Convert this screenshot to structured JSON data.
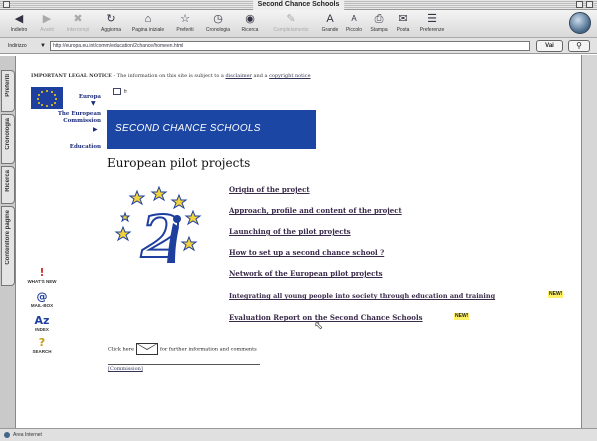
{
  "window": {
    "title": "Second Chance Schools"
  },
  "toolbar": {
    "buttons": [
      {
        "label": "Indietro",
        "icon": "back-arrow-icon",
        "enabled": true
      },
      {
        "label": "Avanti",
        "icon": "forward-arrow-icon",
        "enabled": false
      },
      {
        "label": "Interrompi",
        "icon": "stop-icon",
        "enabled": false
      },
      {
        "label": "Aggiorna",
        "icon": "refresh-icon",
        "enabled": true
      },
      {
        "label": "Pagina iniziale",
        "icon": "home-icon",
        "enabled": true
      },
      {
        "label": "Preferiti",
        "icon": "favorites-icon",
        "enabled": true
      },
      {
        "label": "Cronologia",
        "icon": "history-icon",
        "enabled": true
      },
      {
        "label": "Ricerca",
        "icon": "search-icon",
        "enabled": true
      },
      {
        "label": "Completamento",
        "icon": "autofill-icon",
        "enabled": false
      },
      {
        "label": "Grande",
        "icon": "text-larger-icon",
        "enabled": true
      },
      {
        "label": "Piccolo",
        "icon": "text-smaller-icon",
        "enabled": true
      },
      {
        "label": "Stampa",
        "icon": "print-icon",
        "enabled": true
      },
      {
        "label": "Posta",
        "icon": "mail-icon",
        "enabled": true
      },
      {
        "label": "Preferenze",
        "icon": "preferences-icon",
        "enabled": true
      }
    ]
  },
  "address_bar": {
    "label": "Indirizzo",
    "url": "http://europa.eu.int/comm/education/2chance/homeen.html",
    "go_label": "Vai"
  },
  "side_tabs": [
    "Preferiti",
    "Cronologia",
    "Ricerca",
    "Contenitore pagine"
  ],
  "legal": {
    "bold": "IMPORTANT LEGAL NOTICE",
    "text": " - The information on this site is subject to a ",
    "link1": "disclaimer",
    "mid": " and a ",
    "link2": "copyright notice"
  },
  "left_nav": {
    "europa": "Europa",
    "commission": "The European Commission",
    "education": "Education"
  },
  "lang": "fr",
  "banner_text": "SECOND CHANCE SCHOOLS",
  "page_title": "European pilot projects",
  "links": [
    {
      "text": "Origin of the project",
      "new": false
    },
    {
      "text": "Approach, profile and content of the project",
      "new": false
    },
    {
      "text": "Launching of the pilot projects",
      "new": false
    },
    {
      "text": "How to set up a second chance school ?",
      "new": false
    },
    {
      "text": "Network of the European pilot projects",
      "new": false
    },
    {
      "text": "Integrating all young people into society through education and training",
      "new": true
    },
    {
      "text": "Evaluation Report on the Second Chance Schools",
      "new": true
    }
  ],
  "new_badge": "NEW!",
  "side_icons": [
    {
      "glyph": "!",
      "label": "WHAT'S NEW",
      "icon": "whats-new-icon"
    },
    {
      "glyph": "@",
      "label": "MAIL-BOX",
      "icon": "mailbox-icon"
    },
    {
      "glyph": "Az",
      "label": "INDEX",
      "icon": "index-icon"
    },
    {
      "glyph": "?",
      "label": "SEARCH",
      "icon": "search-help-icon"
    }
  ],
  "contact": {
    "before": "Click here",
    "after": "for further information and comments"
  },
  "bottom_link": "[Commission]",
  "status": "Area Internet"
}
